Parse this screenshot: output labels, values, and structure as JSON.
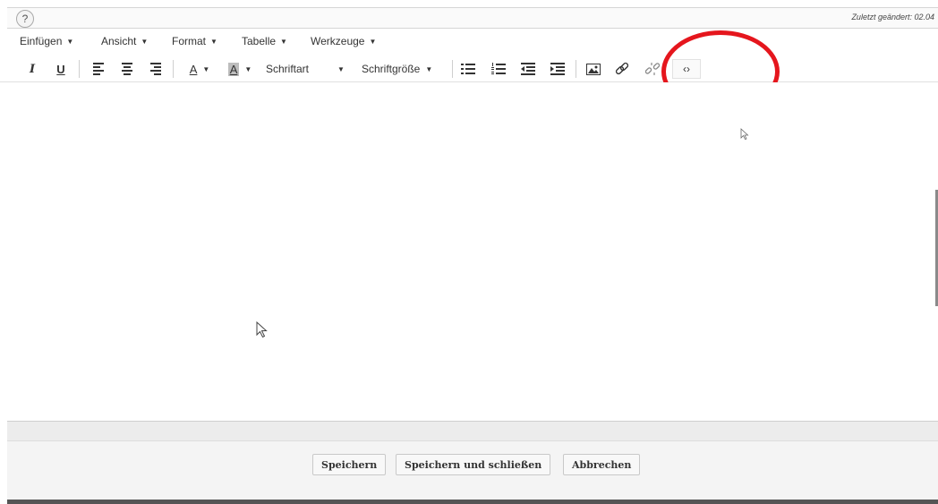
{
  "header": {
    "help_label": "?",
    "last_changed": "Zuletzt geändert: 02.04"
  },
  "menu": {
    "items": [
      {
        "label": "Einfügen"
      },
      {
        "label": "Ansicht"
      },
      {
        "label": "Format"
      },
      {
        "label": "Tabelle"
      },
      {
        "label": "Werkzeuge"
      }
    ]
  },
  "toolbar": {
    "italic": "I",
    "underline": "U",
    "text_color_glyph": "A",
    "bg_color_glyph": "A",
    "font_family_label": "Schriftart",
    "font_size_label": "Schriftgröße",
    "source_code_glyph": "‹›"
  },
  "footer": {
    "save": "Speichern",
    "save_close": "Speichern und schließen",
    "cancel": "Abbrechen"
  },
  "colors": {
    "highlight": "#e5161d"
  }
}
